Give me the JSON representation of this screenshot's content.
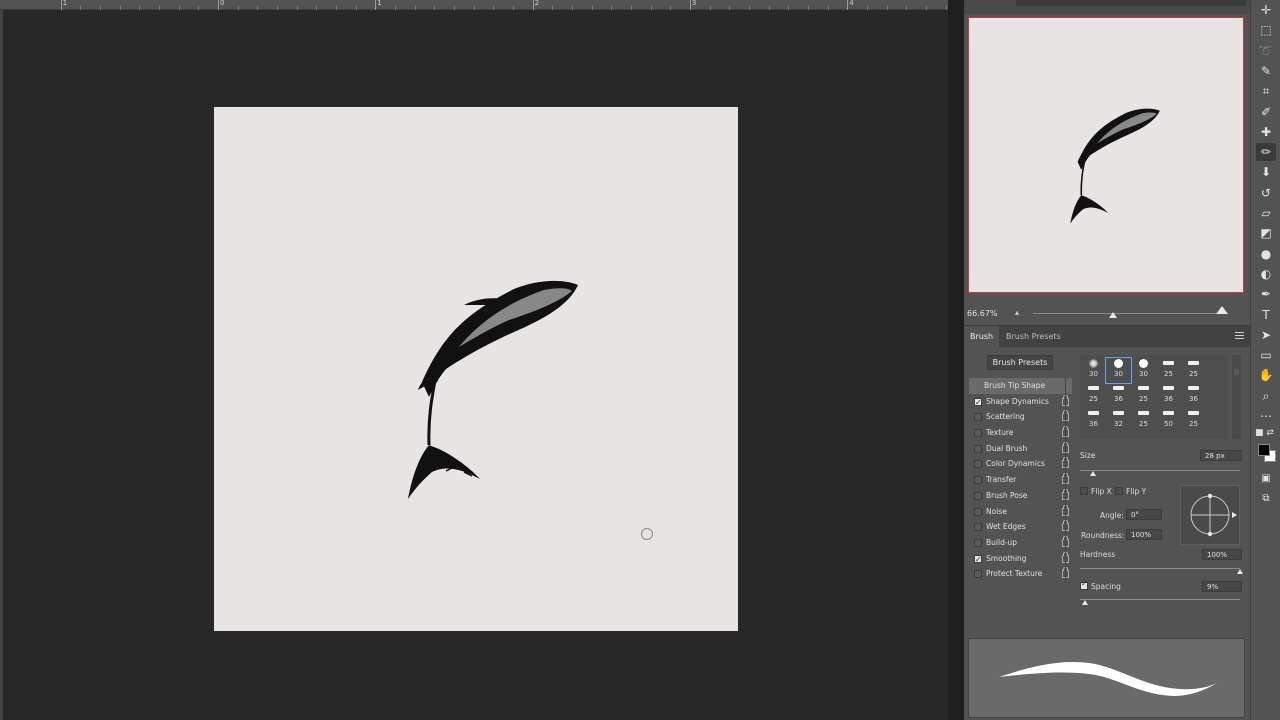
{
  "ruler": {
    "labels": [
      "1",
      "0",
      "1",
      "2",
      "3",
      "4"
    ]
  },
  "navigator": {
    "zoom_level": "66.67%"
  },
  "brush_panel": {
    "tabs": [
      "Brush",
      "Brush Presets"
    ],
    "presets_button": "Brush Presets",
    "options": [
      {
        "label": "Brush Tip Shape",
        "checked": null
      },
      {
        "label": "Shape Dynamics",
        "checked": true
      },
      {
        "label": "Scattering",
        "checked": false
      },
      {
        "label": "Texture",
        "checked": false
      },
      {
        "label": "Dual Brush",
        "checked": false
      },
      {
        "label": "Color Dynamics",
        "checked": false
      },
      {
        "label": "Transfer",
        "checked": false
      },
      {
        "label": "Brush Pose",
        "checked": false
      },
      {
        "label": "Noise",
        "checked": false
      },
      {
        "label": "Wet Edges",
        "checked": false
      },
      {
        "label": "Build-up",
        "checked": false
      },
      {
        "label": "Smoothing",
        "checked": true
      },
      {
        "label": "Protect Texture",
        "checked": false
      }
    ],
    "tip_sizes": [
      [
        "30",
        "30",
        "30",
        "25",
        "25"
      ],
      [
        "25",
        "36",
        "25",
        "36",
        "36"
      ],
      [
        "36",
        "32",
        "25",
        "50",
        "25"
      ]
    ],
    "size_label": "Size",
    "size_value": "28 px",
    "size_fraction": 0.08,
    "flip_x": "Flip X",
    "flip_y": "Flip Y",
    "angle_label": "Angle:",
    "angle_value": "0°",
    "roundness_label": "Roundness:",
    "roundness_value": "100%",
    "hardness_label": "Hardness",
    "hardness_value": "100%",
    "hardness_fraction": 1.0,
    "spacing_label": "Spacing",
    "spacing_value": "9%",
    "spacing_checked": true,
    "spacing_fraction": 0.03
  },
  "colors": {
    "canvas_bg": "#e9e4e4",
    "workspace": "#282828",
    "panel": "#535353",
    "navigator_border": "#d23a3a",
    "foreground": "#000000",
    "background": "#ffffff"
  },
  "toolbar": {
    "tools": [
      "move-icon",
      "marquee-icon",
      "lasso-icon",
      "quick-select-icon",
      "crop-icon",
      "eyedropper-icon",
      "healing-icon",
      "brush-icon",
      "stamp-icon",
      "history-brush-icon",
      "eraser-icon",
      "bucket-icon",
      "blur-icon",
      "dodge-icon",
      "pen-icon",
      "type-icon",
      "path-select-icon",
      "rectangle-icon",
      "hand-icon",
      "zoom-icon",
      "more-icon"
    ],
    "active_tool": "brush-icon"
  }
}
